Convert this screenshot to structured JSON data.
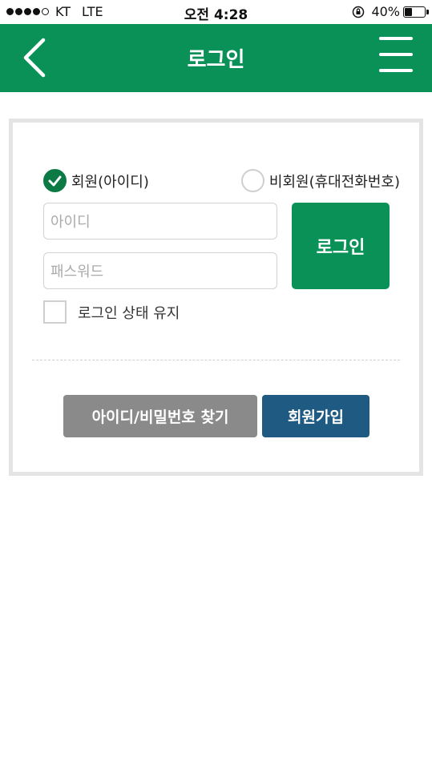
{
  "status_bar": {
    "carrier": "KT",
    "network": "LTE",
    "time": "오전 4:28",
    "battery_percent_label": "40%",
    "battery_level": 0.4
  },
  "header": {
    "title": "로그인",
    "background_color": "#0a9158"
  },
  "login_form": {
    "member_type_options": {
      "member_label": "회원(아이디)",
      "guest_label": "비회원(휴대전화번호)",
      "selected": "member"
    },
    "id_placeholder": "아이디",
    "password_placeholder": "패스워드",
    "login_button_label": "로그인",
    "keep_logged_in_label": "로그인 상태 유지",
    "keep_logged_in_checked": false
  },
  "actions": {
    "find_account_label": "아이디/비밀번호 찾기",
    "join_label": "회원가입"
  },
  "icons": {
    "back": "chevron-left-icon",
    "menu": "hamburger-menu-icon",
    "check": "checkmark-icon",
    "orientation_lock": "orientation-lock-icon",
    "battery": "battery-icon"
  }
}
